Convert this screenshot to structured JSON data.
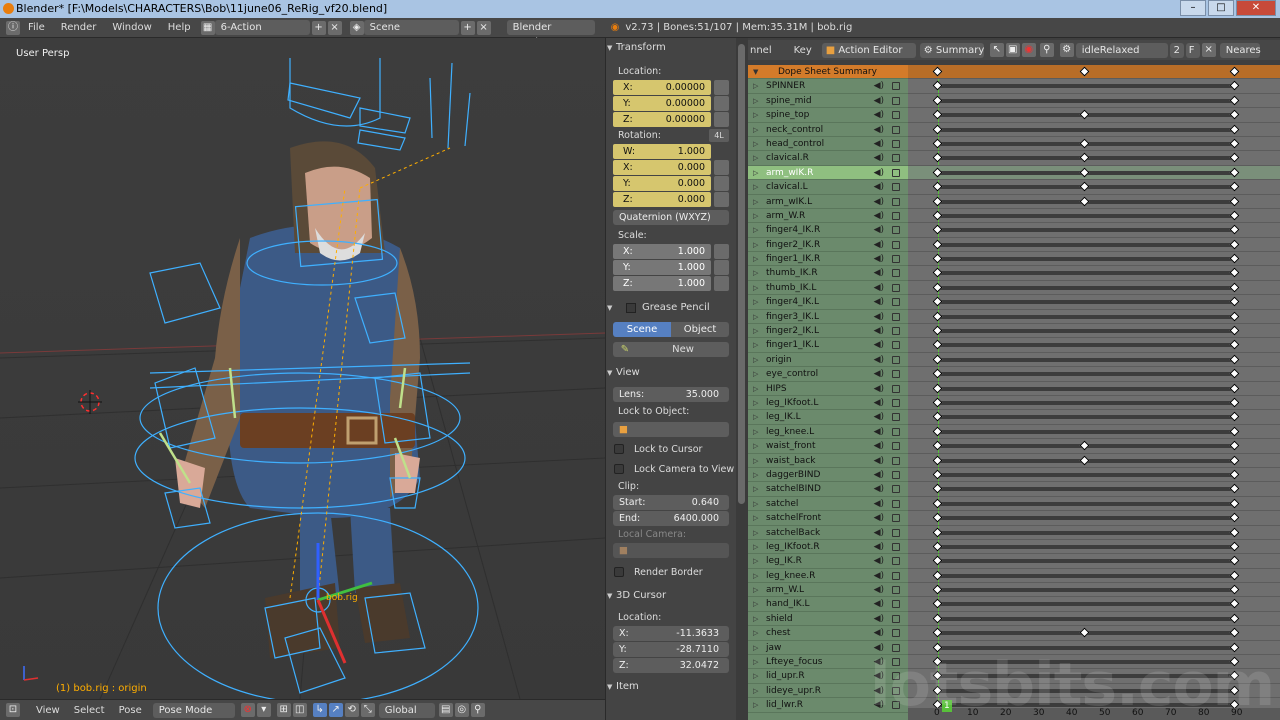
{
  "window": {
    "title": "Blender* [F:\\Models\\CHARACTERS\\Bob\\11june06_ReRig_vf20.blend]",
    "min": "–",
    "max": "□",
    "close": "✕"
  },
  "infobar": {
    "menus": [
      "File",
      "Render",
      "Window",
      "Help"
    ],
    "screen": "6-Action",
    "scene": "Scene",
    "engine": "Blender Render",
    "stats": "v2.73 | Bones:51/107 | Mem:35.31M | bob.rig"
  },
  "viewport": {
    "view_label": "User Persp",
    "object_label": "(1) bob.rig : origin",
    "bone_label": "bob.rig",
    "bottom": {
      "menus": [
        "View",
        "Select",
        "Pose"
      ],
      "mode": "Pose Mode",
      "orientation": "Global"
    }
  },
  "properties": {
    "transform": {
      "title": "Transform",
      "location_label": "Location:",
      "location": [
        {
          "k": "X:",
          "v": "0.00000"
        },
        {
          "k": "Y:",
          "v": "0.00000"
        },
        {
          "k": "Z:",
          "v": "0.00000"
        }
      ],
      "rotation_label": "Rotation:",
      "rotation_mode_btn": "4L",
      "rotation": [
        {
          "k": "W:",
          "v": "1.000"
        },
        {
          "k": "X:",
          "v": "0.000"
        },
        {
          "k": "Y:",
          "v": "0.000"
        },
        {
          "k": "Z:",
          "v": "0.000"
        }
      ],
      "rotation_mode": "Quaternion (WXYZ)",
      "scale_label": "Scale:",
      "scale": [
        {
          "k": "X:",
          "v": "1.000"
        },
        {
          "k": "Y:",
          "v": "1.000"
        },
        {
          "k": "Z:",
          "v": "1.000"
        }
      ]
    },
    "grease_pencil": {
      "title": "Grease Pencil",
      "tab_scene": "Scene",
      "tab_object": "Object",
      "new": "New"
    },
    "view": {
      "title": "View",
      "lens_label": "Lens:",
      "lens": "35.000",
      "lock_object_label": "Lock to Object:",
      "lock_cursor": "Lock to Cursor",
      "lock_camera": "Lock Camera to View",
      "clip_label": "Clip:",
      "clip_start_label": "Start:",
      "clip_start": "0.640",
      "clip_end_label": "End:",
      "clip_end": "6400.000",
      "local_camera_label": "Local Camera:",
      "render_border": "Render Border"
    },
    "cursor": {
      "title": "3D Cursor",
      "location_label": "Location:",
      "location": [
        {
          "k": "X:",
          "v": "-11.3633"
        },
        {
          "k": "Y:",
          "v": "-28.7110"
        },
        {
          "k": "Z:",
          "v": "32.0472"
        }
      ]
    },
    "item": {
      "title": "Item"
    }
  },
  "dopesheet": {
    "header": {
      "channel": "nnel",
      "key": "Key",
      "mode": "Action Editor",
      "summary": "Summary",
      "action": "idleRelaxed",
      "users": "2",
      "fake": "F",
      "nearest": "Neares"
    },
    "summary_label": "Dope Sheet Summary",
    "channels": [
      "SPINNER",
      "spine_mid",
      "spine_top",
      "neck_control",
      "head_control",
      "clavical.R",
      "arm_wIK.R",
      "clavical.L",
      "arm_wIK.L",
      "arm_W.R",
      "finger4_IK.R",
      "finger2_IK.R",
      "finger1_IK.R",
      "thumb_IK.R",
      "thumb_IK.L",
      "finger4_IK.L",
      "finger3_IK.L",
      "finger2_IK.L",
      "finger1_IK.L",
      "origin",
      "eye_control",
      "HIPS",
      "leg_IKfoot.L",
      "leg_IK.L",
      "leg_knee.L",
      "waist_front",
      "waist_back",
      "daggerBIND",
      "satchelBIND",
      "satchel",
      "satchelFront",
      "satchelBack",
      "leg_IKfoot.R",
      "leg_IK.R",
      "leg_knee.R",
      "arm_W.L",
      "hand_IK.L",
      "shield",
      "chest",
      "jaw",
      "Lfteye_focus",
      "lid_upr.R",
      "lideye_upr.R",
      "lid_lwr.R"
    ],
    "mid_key_channels": [
      "spine_top",
      "head_control",
      "clavical.R",
      "arm_wIK.R",
      "clavical.L",
      "arm_wIK.L",
      "waist_front",
      "waist_back",
      "chest"
    ],
    "selected_channel": "arm_wIK.R",
    "frame_ticks": [
      "0",
      "10",
      "20",
      "30",
      "40",
      "50",
      "60",
      "70",
      "80",
      "90"
    ],
    "current_frame": "1",
    "key_frames": [
      0,
      45,
      90
    ]
  },
  "watermark": "lotsbits.com"
}
